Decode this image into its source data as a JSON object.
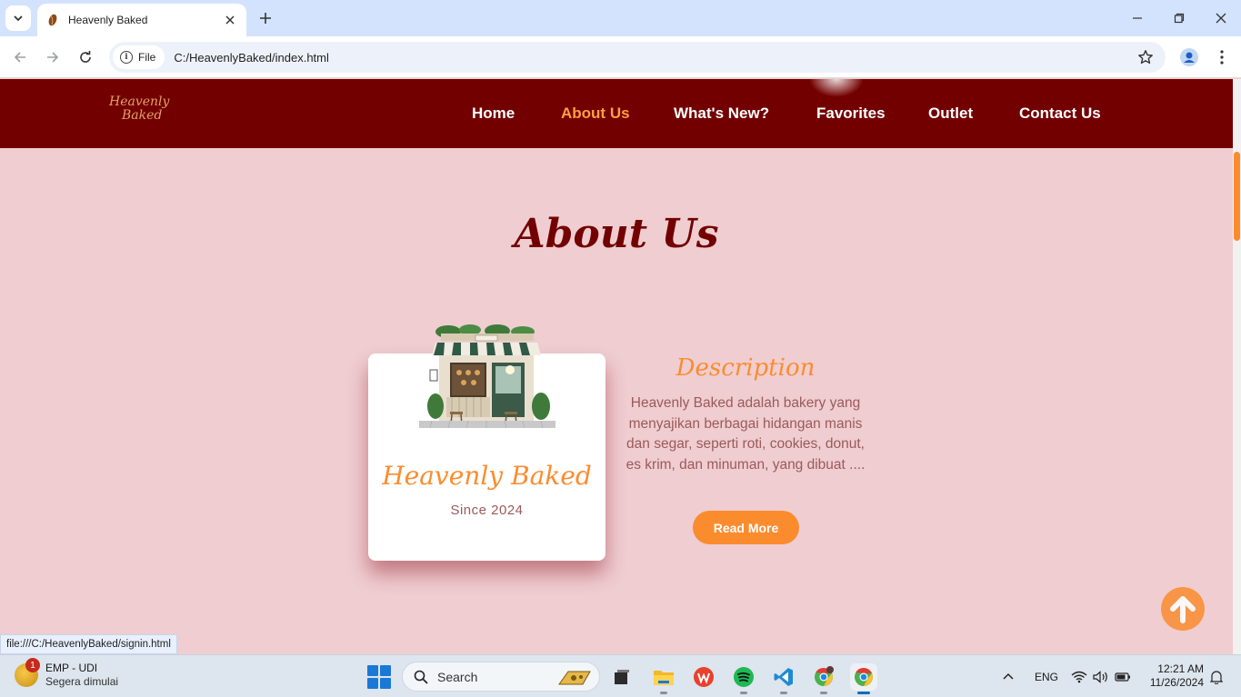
{
  "browser": {
    "tab_title": "Heavenly Baked",
    "url_chip": "File",
    "url": "C:/HeavenlyBaked/index.html",
    "status_url": "file:///C:/HeavenlyBaked/signin.html"
  },
  "site": {
    "logo": {
      "line1": "Heavenly",
      "line2": "Baked"
    },
    "nav": [
      "Home",
      "About Us",
      "What's New?",
      "Favorites",
      "Outlet",
      "Contact Us"
    ],
    "active_nav": "About Us",
    "section_title": "About Us",
    "card": {
      "name": "Heavenly Baked",
      "since": "Since 2024"
    },
    "description": {
      "title": "Description",
      "text": "Heavenly Baked adalah bakery yang menyajikan berbagai hidangan manis dan segar, seperti roti, cookies, donut, es krim, dan minuman, yang dibuat ....",
      "button": "Read More"
    }
  },
  "taskbar": {
    "weather_title": "EMP - UDI",
    "weather_sub": "Segera dimulai",
    "weather_badge": "1",
    "search_label": "Search",
    "language": "ENG",
    "time": "12:21 AM",
    "date": "11/26/2024"
  },
  "colors": {
    "nav_bg": "#730000",
    "page_bg": "#efcdd1",
    "accent": "#fb8c2e",
    "title_color": "#730000"
  }
}
